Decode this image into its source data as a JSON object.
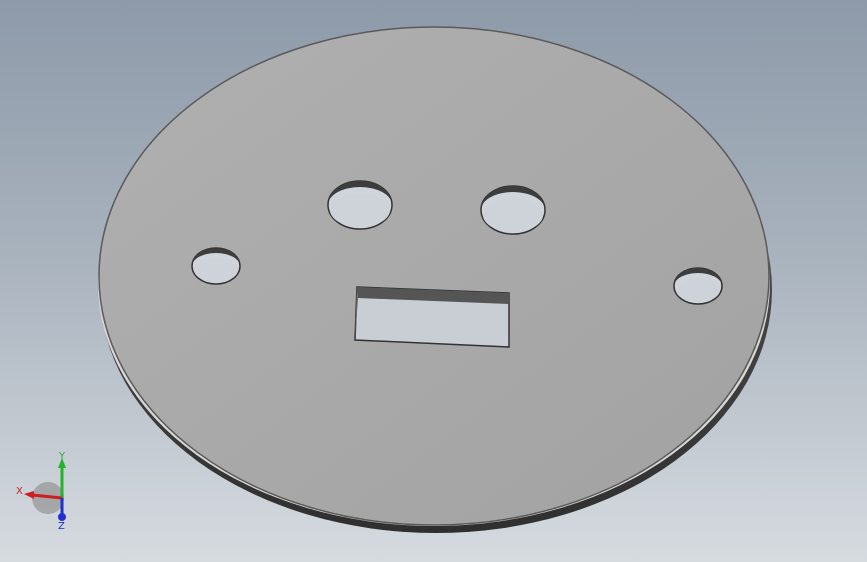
{
  "viewport": {
    "background_top": "#8d9aa9",
    "background_bottom": "#d6dbe0"
  },
  "part": {
    "face_color": "#a7a7a7",
    "edge_color": "#4a4a4a",
    "hole_count": 4,
    "slot_count": 1
  },
  "triad": {
    "x_label": "X",
    "y_label": "Y",
    "z_label": "Z",
    "x_color": "#cc1f1f",
    "y_color": "#22b22b",
    "z_color": "#1f2fcc"
  }
}
